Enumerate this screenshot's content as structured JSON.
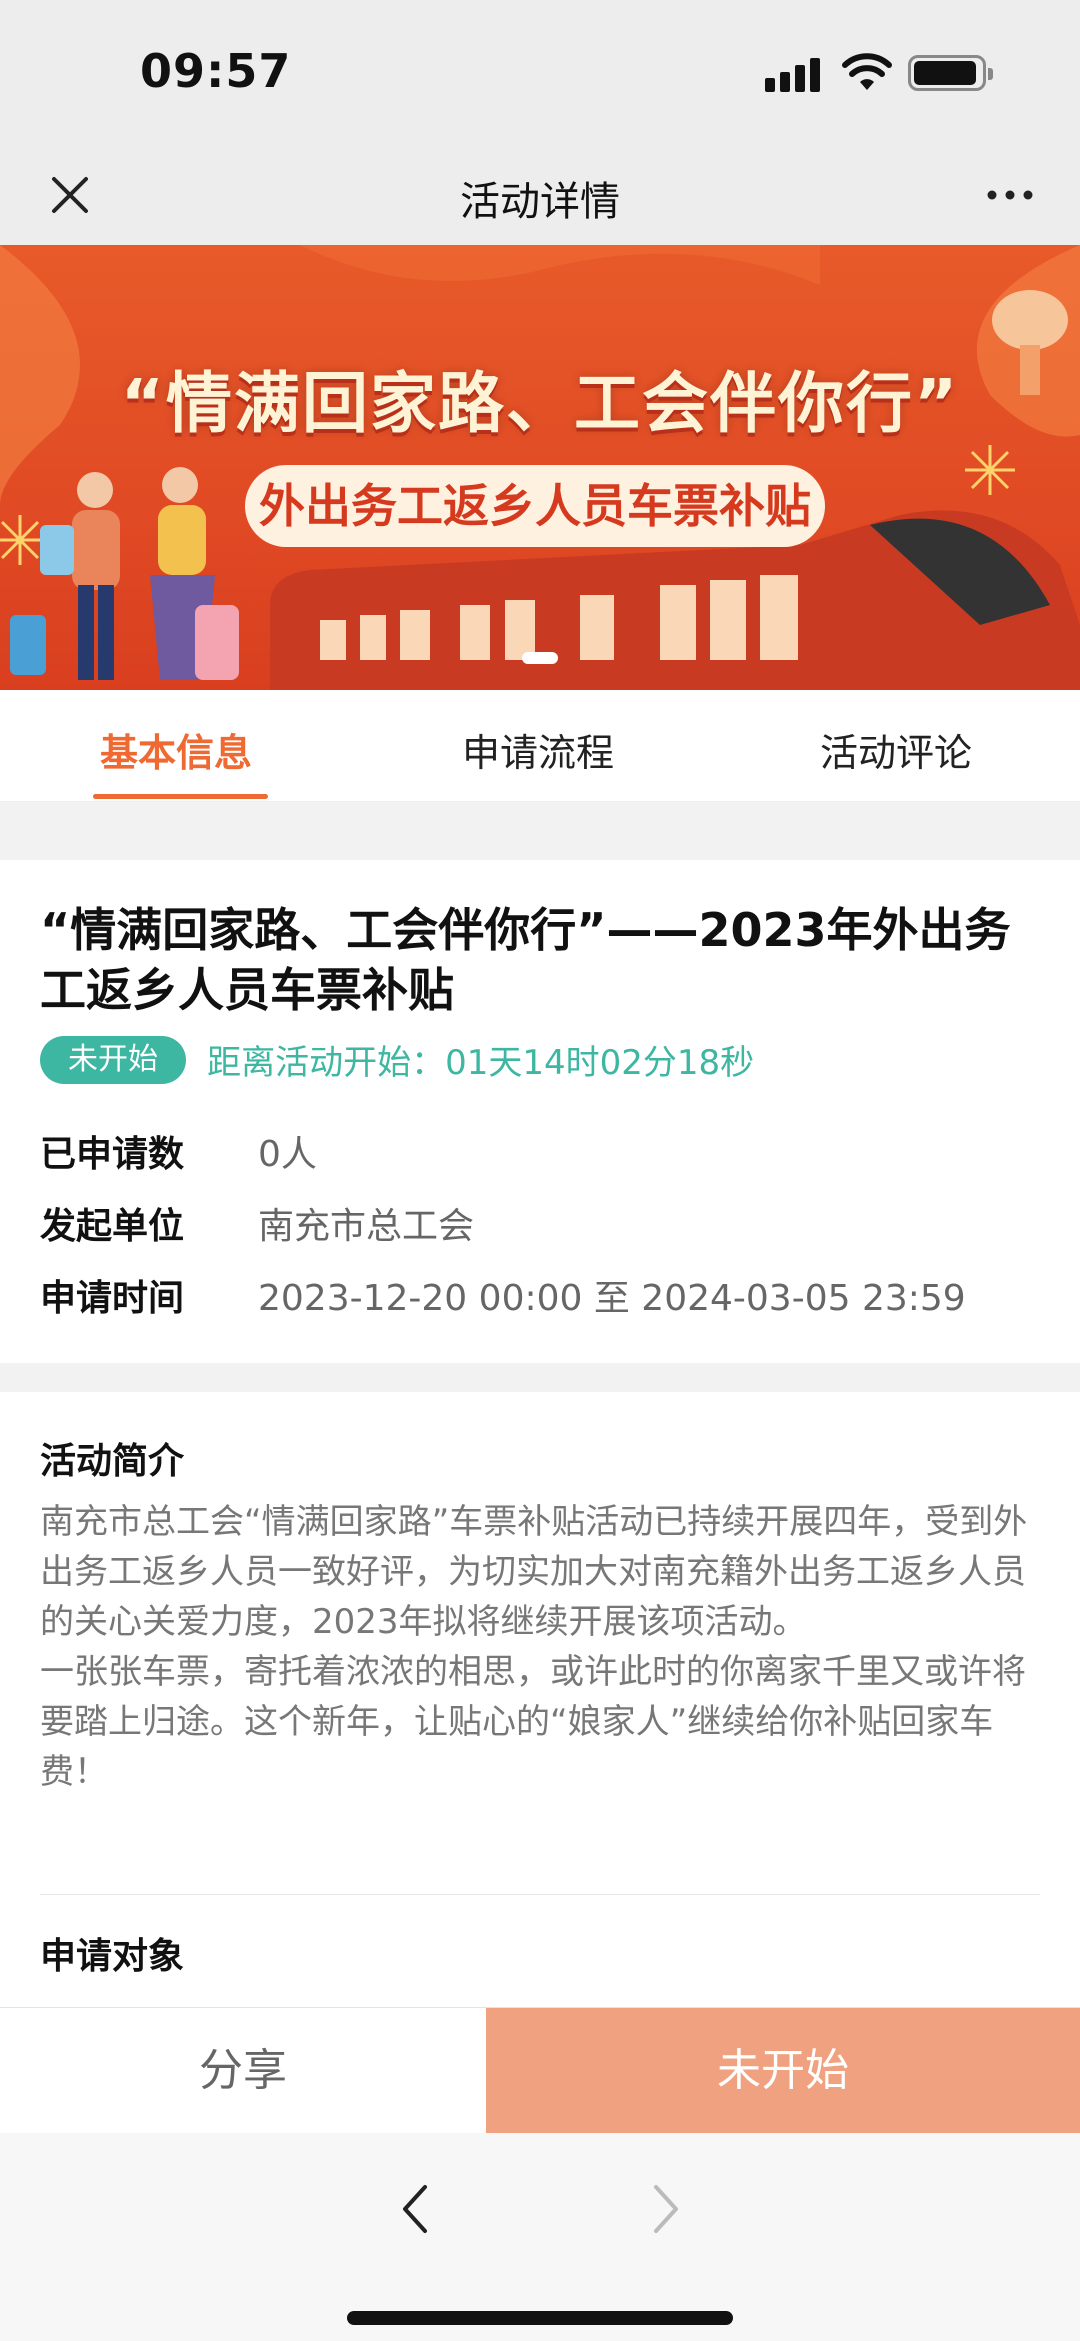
{
  "status_bar": {
    "time": "09:57"
  },
  "nav": {
    "title": "活动详情"
  },
  "banner": {
    "headline": "“情满回家路、工会伴你行”",
    "subhead": "外出务工返乡人员车票补贴"
  },
  "tabs": [
    {
      "label": "基本信息",
      "active": true
    },
    {
      "label": "申请流程",
      "active": false
    },
    {
      "label": "活动评论",
      "active": false
    }
  ],
  "event": {
    "title": "“情满回家路、工会伴你行”——2023年外出务工返乡人员车票补贴",
    "status": "未开始",
    "countdown": "距离活动开始：01天14时02分18秒",
    "details": [
      {
        "label": "已申请数",
        "value": "0人"
      },
      {
        "label": "发起单位",
        "value": "南充市总工会"
      },
      {
        "label": "申请时间",
        "value": "2023-12-20 00:00 至 2024-03-05 23:59"
      }
    ]
  },
  "intro": {
    "heading": "活动简介",
    "paragraphs": [
      "南充市总工会“情满回家路”车票补贴活动已持续开展四年，受到外出务工返乡人员一致好评，为切实加大对南充籍外出务工返乡人员的关心关爱力度，2023年拟将继续开展该项活动。",
      "一张张车票，寄托着浓浓的相思，或许此时的你离家千里又或许将要踏上归途。这个新年，让贴心的“娘家人”继续给你补贴回家车费！"
    ],
    "next_heading": "申请对象"
  },
  "actions": {
    "share_label": "分享",
    "primary_label": "未开始"
  },
  "colors": {
    "accent": "#ee6a32",
    "teal": "#3db6a2",
    "disabled_button": "#f0a280",
    "banner_red": "#e04a24"
  }
}
